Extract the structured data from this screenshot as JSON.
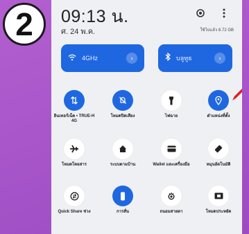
{
  "step_number": "2",
  "status": {
    "time": "09:13 น.",
    "date": "ศ. 24 พ.ค.",
    "storage": "ใช้ไปแล้ว 6.72 GB"
  },
  "tiles": {
    "wifi": {
      "label": "4GHz",
      "icon": "wifi-icon"
    },
    "bluetooth": {
      "label": "บลูทูธ",
      "icon": "bluetooth-icon"
    }
  },
  "toggles": [
    {
      "label": "อินเทอร์เน็ต • TRUE-H 4G",
      "icon": "mobile-data-icon",
      "on": true
    },
    {
      "label": "โหมดปิดเสียง",
      "icon": "mute-bell-icon",
      "on": true
    },
    {
      "label": "ไฟฉาย",
      "icon": "flashlight-icon",
      "on": false
    },
    {
      "label": "ตำแหน่งที่ตั้ง",
      "icon": "location-icon",
      "on": true
    },
    {
      "label": "โหมดโดยสาร",
      "icon": "airplane-icon",
      "on": false
    },
    {
      "label": "ระบบตามบ้าน",
      "icon": "home-icon",
      "on": false
    },
    {
      "label": "Wallet และเครื่องมือ",
      "icon": "wallet-icon",
      "on": false
    },
    {
      "label": "หมุนอัตโนมัติ",
      "icon": "auto-rotate-icon",
      "on": false
    },
    {
      "label": "Quick Share ช่วง",
      "icon": "quick-share-icon",
      "on": false
    },
    {
      "label": "การสั่น",
      "icon": "vibrate-icon",
      "on": true
    },
    {
      "label": "ถนอมสายตา",
      "icon": "eye-comfort-icon",
      "on": false
    },
    {
      "label": "โหมดประหยัด",
      "icon": "power-saving-icon",
      "on": false
    }
  ],
  "colors": {
    "accent": "#1f67e0",
    "panel": "#eef0f3",
    "background": "#a553c8",
    "arrow": "#e02020"
  }
}
